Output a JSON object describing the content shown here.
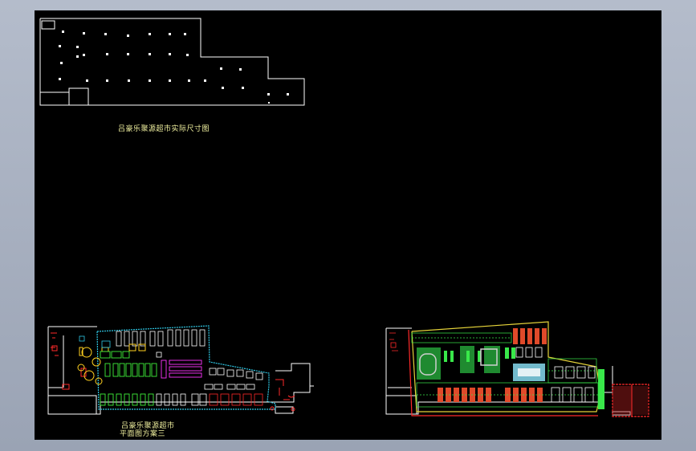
{
  "drawing": {
    "title_1": "吕豪乐聚源超市实际尺寸图",
    "title_2_line1": "吕豪乐聚源超市",
    "title_2_line2": "平面图方案三"
  }
}
